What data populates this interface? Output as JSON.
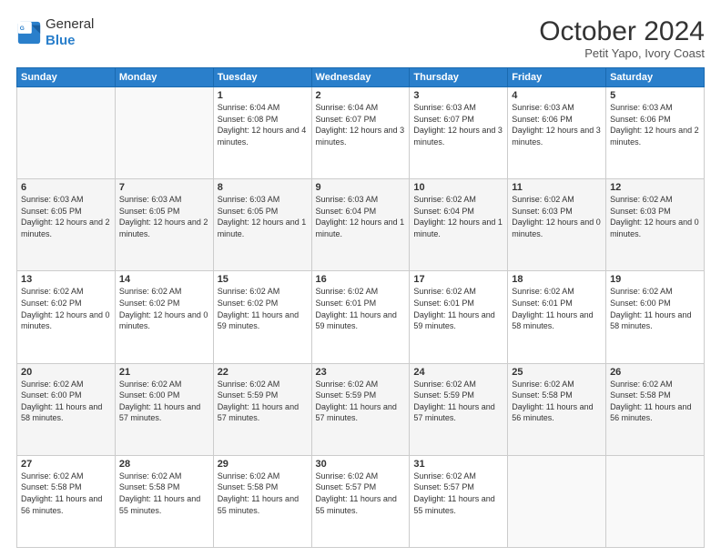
{
  "header": {
    "logo_line1": "General",
    "logo_line2": "Blue",
    "title": "October 2024",
    "subtitle": "Petit Yapo, Ivory Coast"
  },
  "weekdays": [
    "Sunday",
    "Monday",
    "Tuesday",
    "Wednesday",
    "Thursday",
    "Friday",
    "Saturday"
  ],
  "weeks": [
    [
      {
        "day": "",
        "info": ""
      },
      {
        "day": "",
        "info": ""
      },
      {
        "day": "1",
        "info": "Sunrise: 6:04 AM\nSunset: 6:08 PM\nDaylight: 12 hours and 4 minutes."
      },
      {
        "day": "2",
        "info": "Sunrise: 6:04 AM\nSunset: 6:07 PM\nDaylight: 12 hours and 3 minutes."
      },
      {
        "day": "3",
        "info": "Sunrise: 6:03 AM\nSunset: 6:07 PM\nDaylight: 12 hours and 3 minutes."
      },
      {
        "day": "4",
        "info": "Sunrise: 6:03 AM\nSunset: 6:06 PM\nDaylight: 12 hours and 3 minutes."
      },
      {
        "day": "5",
        "info": "Sunrise: 6:03 AM\nSunset: 6:06 PM\nDaylight: 12 hours and 2 minutes."
      }
    ],
    [
      {
        "day": "6",
        "info": "Sunrise: 6:03 AM\nSunset: 6:05 PM\nDaylight: 12 hours and 2 minutes."
      },
      {
        "day": "7",
        "info": "Sunrise: 6:03 AM\nSunset: 6:05 PM\nDaylight: 12 hours and 2 minutes."
      },
      {
        "day": "8",
        "info": "Sunrise: 6:03 AM\nSunset: 6:05 PM\nDaylight: 12 hours and 1 minute."
      },
      {
        "day": "9",
        "info": "Sunrise: 6:03 AM\nSunset: 6:04 PM\nDaylight: 12 hours and 1 minute."
      },
      {
        "day": "10",
        "info": "Sunrise: 6:02 AM\nSunset: 6:04 PM\nDaylight: 12 hours and 1 minute."
      },
      {
        "day": "11",
        "info": "Sunrise: 6:02 AM\nSunset: 6:03 PM\nDaylight: 12 hours and 0 minutes."
      },
      {
        "day": "12",
        "info": "Sunrise: 6:02 AM\nSunset: 6:03 PM\nDaylight: 12 hours and 0 minutes."
      }
    ],
    [
      {
        "day": "13",
        "info": "Sunrise: 6:02 AM\nSunset: 6:02 PM\nDaylight: 12 hours and 0 minutes."
      },
      {
        "day": "14",
        "info": "Sunrise: 6:02 AM\nSunset: 6:02 PM\nDaylight: 12 hours and 0 minutes."
      },
      {
        "day": "15",
        "info": "Sunrise: 6:02 AM\nSunset: 6:02 PM\nDaylight: 11 hours and 59 minutes."
      },
      {
        "day": "16",
        "info": "Sunrise: 6:02 AM\nSunset: 6:01 PM\nDaylight: 11 hours and 59 minutes."
      },
      {
        "day": "17",
        "info": "Sunrise: 6:02 AM\nSunset: 6:01 PM\nDaylight: 11 hours and 59 minutes."
      },
      {
        "day": "18",
        "info": "Sunrise: 6:02 AM\nSunset: 6:01 PM\nDaylight: 11 hours and 58 minutes."
      },
      {
        "day": "19",
        "info": "Sunrise: 6:02 AM\nSunset: 6:00 PM\nDaylight: 11 hours and 58 minutes."
      }
    ],
    [
      {
        "day": "20",
        "info": "Sunrise: 6:02 AM\nSunset: 6:00 PM\nDaylight: 11 hours and 58 minutes."
      },
      {
        "day": "21",
        "info": "Sunrise: 6:02 AM\nSunset: 6:00 PM\nDaylight: 11 hours and 57 minutes."
      },
      {
        "day": "22",
        "info": "Sunrise: 6:02 AM\nSunset: 5:59 PM\nDaylight: 11 hours and 57 minutes."
      },
      {
        "day": "23",
        "info": "Sunrise: 6:02 AM\nSunset: 5:59 PM\nDaylight: 11 hours and 57 minutes."
      },
      {
        "day": "24",
        "info": "Sunrise: 6:02 AM\nSunset: 5:59 PM\nDaylight: 11 hours and 57 minutes."
      },
      {
        "day": "25",
        "info": "Sunrise: 6:02 AM\nSunset: 5:58 PM\nDaylight: 11 hours and 56 minutes."
      },
      {
        "day": "26",
        "info": "Sunrise: 6:02 AM\nSunset: 5:58 PM\nDaylight: 11 hours and 56 minutes."
      }
    ],
    [
      {
        "day": "27",
        "info": "Sunrise: 6:02 AM\nSunset: 5:58 PM\nDaylight: 11 hours and 56 minutes."
      },
      {
        "day": "28",
        "info": "Sunrise: 6:02 AM\nSunset: 5:58 PM\nDaylight: 11 hours and 55 minutes."
      },
      {
        "day": "29",
        "info": "Sunrise: 6:02 AM\nSunset: 5:58 PM\nDaylight: 11 hours and 55 minutes."
      },
      {
        "day": "30",
        "info": "Sunrise: 6:02 AM\nSunset: 5:57 PM\nDaylight: 11 hours and 55 minutes."
      },
      {
        "day": "31",
        "info": "Sunrise: 6:02 AM\nSunset: 5:57 PM\nDaylight: 11 hours and 55 minutes."
      },
      {
        "day": "",
        "info": ""
      },
      {
        "day": "",
        "info": ""
      }
    ]
  ]
}
